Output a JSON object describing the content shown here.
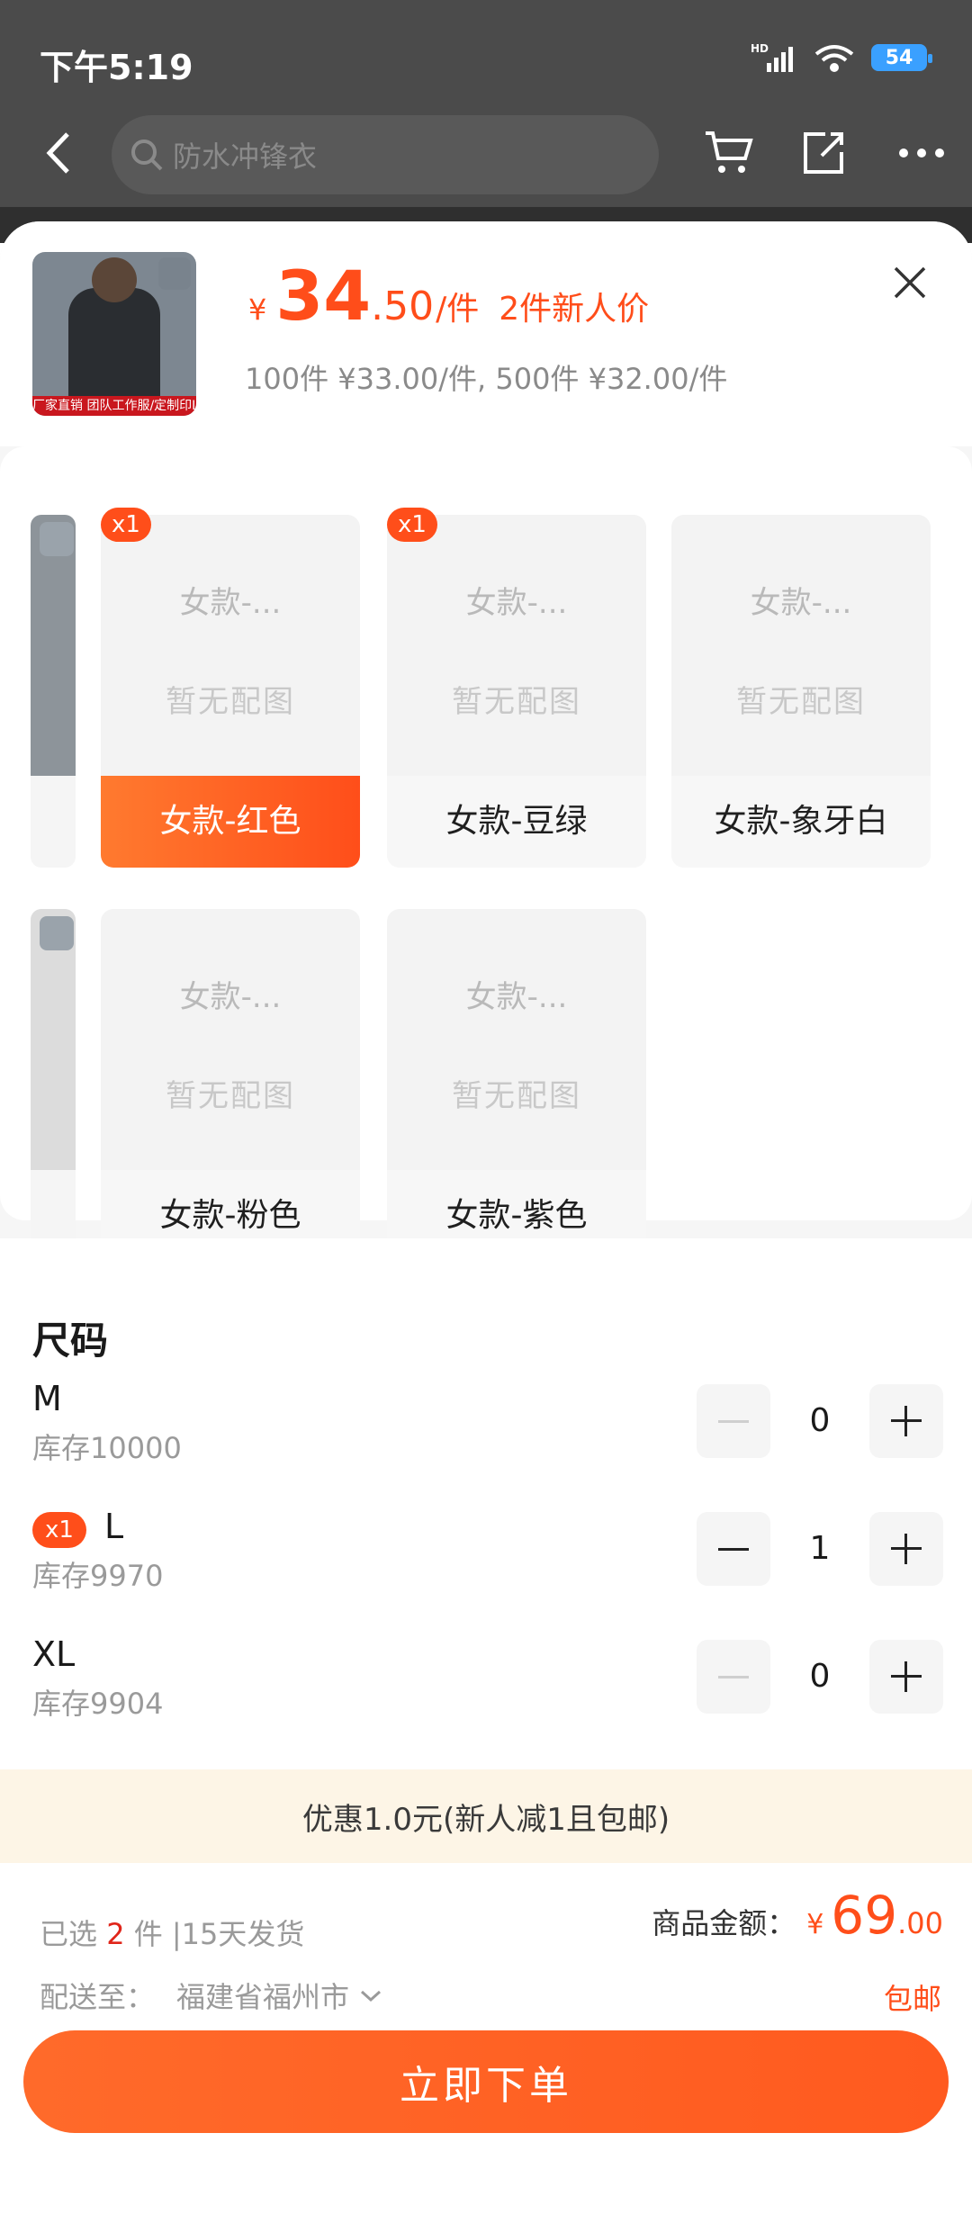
{
  "status_bar": {
    "time": "下午5:19",
    "battery": "54",
    "network_label": "HD"
  },
  "search": {
    "placeholder": "防水冲锋衣"
  },
  "product": {
    "thumb_banner": "厂家直销  团队工作服/定制印Logo",
    "currency": "¥",
    "price_int": "34",
    "price_dec": ".50",
    "price_unit": "/件",
    "price_tag": "2件新人价",
    "tier_text": "100件 ¥33.00/件, 500件 ¥32.00/件"
  },
  "colors_row1": [
    {
      "caption": "女款-...",
      "placeholder": "暂无配图",
      "label": "女款-红色",
      "badge": "x1"
    },
    {
      "caption": "女款-...",
      "placeholder": "暂无配图",
      "label": "女款-豆绿",
      "badge": "x1"
    },
    {
      "caption": "女款-...",
      "placeholder": "暂无配图",
      "label": "女款-象牙白",
      "badge": ""
    }
  ],
  "colors_row2": [
    {
      "caption": "女款-...",
      "placeholder": "暂无配图",
      "label": "女款-粉色"
    },
    {
      "caption": "女款-...",
      "placeholder": "暂无配图",
      "label": "女款-紫色"
    }
  ],
  "size_section": {
    "title": "尺码",
    "rows": [
      {
        "name": "M",
        "stock": "库存10000",
        "qty": "0",
        "badge": ""
      },
      {
        "name": "L",
        "stock": "库存9970",
        "qty": "1",
        "badge": "x1"
      },
      {
        "name": "XL",
        "stock": "库存9904",
        "qty": "0",
        "badge": ""
      }
    ]
  },
  "promo": {
    "text": "优惠1.0元(新人减1且包邮)"
  },
  "footer": {
    "selected_prefix": "已选",
    "selected_count": "2",
    "selected_suffix": "件 |15天发货",
    "total_label": "商品金额：",
    "total_currency": "¥",
    "total_int": "69",
    "total_dec": ".00",
    "ship_label": "配送至：",
    "ship_addr": "福建省福州市",
    "free_shipping": "包邮",
    "order_button": "立即下单"
  },
  "accent_color": "#ff4e1a"
}
